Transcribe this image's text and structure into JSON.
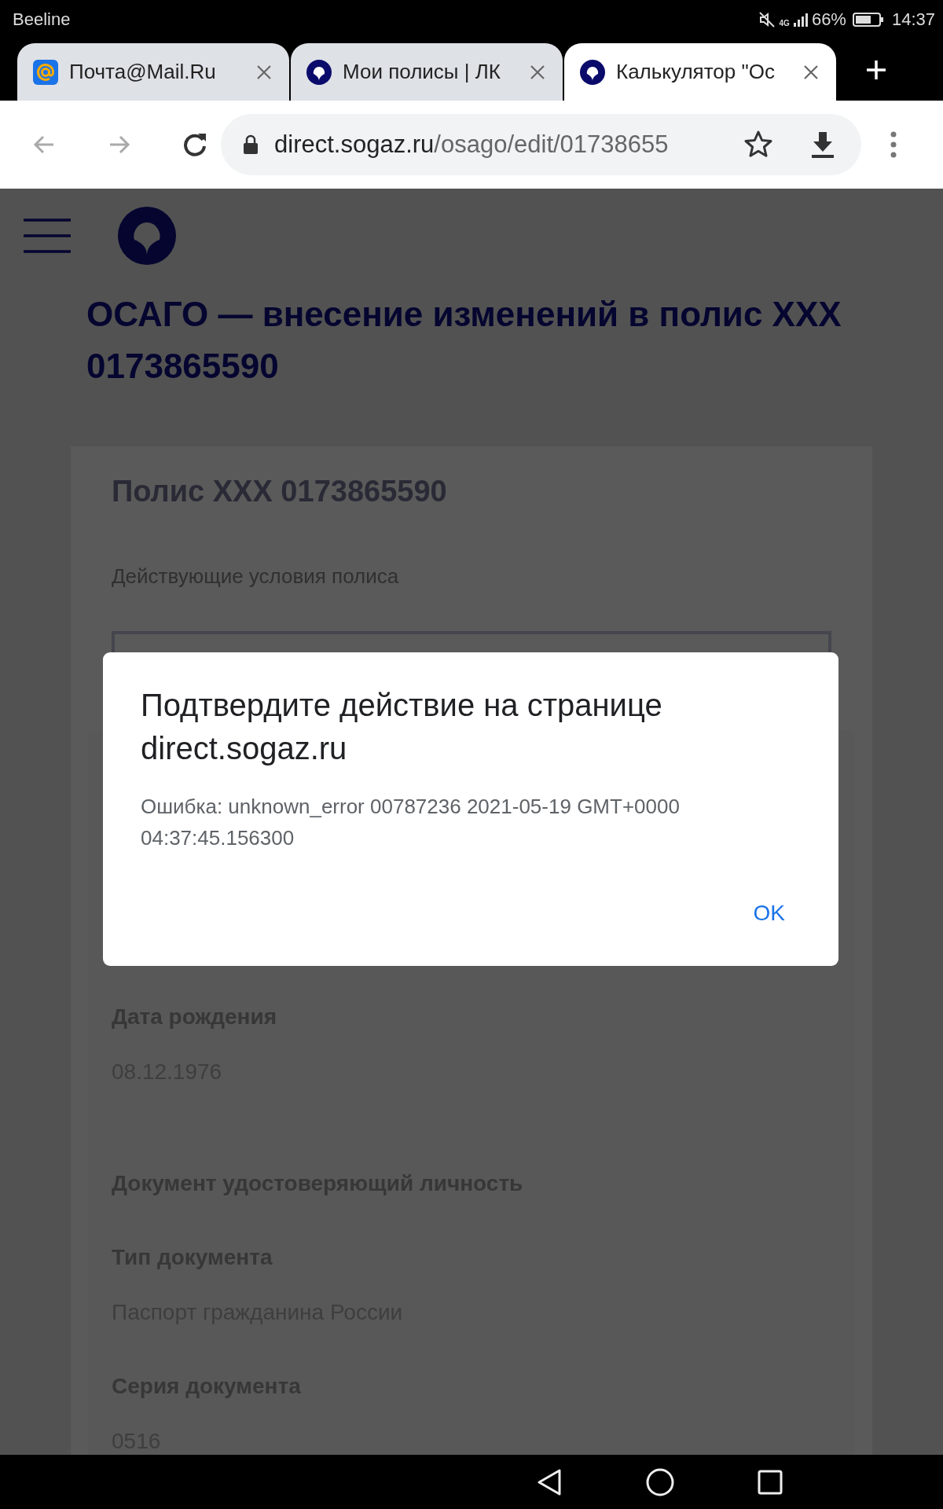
{
  "status_bar": {
    "carrier": "Beeline",
    "network": "4G",
    "battery": "66%",
    "time": "14:37",
    "muted": true
  },
  "tabs": [
    {
      "title": "Почта@Mail.Ru",
      "selected": false
    },
    {
      "title": "Мои полисы | ЛК",
      "selected": false
    },
    {
      "title": "Калькулятор \"Ос",
      "selected": true
    }
  ],
  "toolbar": {
    "back_disabled": true,
    "forward_disabled": true,
    "url_host": "direct.sogaz.ru",
    "url_path": "/osago/edit/01738655"
  },
  "page": {
    "title": "ОСАГО — внесение изменений в полис ХХХ 0173865590",
    "card": {
      "heading": "Полис ХХХ 0173865590",
      "subtitle": "Действующие условия полиса",
      "fields": [
        {
          "kind": "label",
          "text": "Дата рождения"
        },
        {
          "kind": "value",
          "text": "08.12.1976"
        },
        {
          "kind": "section",
          "text": "Документ удостоверяющий личность"
        },
        {
          "kind": "label",
          "text": "Тип документа"
        },
        {
          "kind": "value",
          "text": "Паспорт гражданина России"
        },
        {
          "kind": "label",
          "text": "Серия документа"
        },
        {
          "kind": "value",
          "text": "0516"
        }
      ]
    }
  },
  "dialog": {
    "title": "Подтвердите действие на странице direct.sogaz.ru",
    "message": "Ошибка: unknown_error 00787236 2021-05-19 GMT+0000 04:37:45.156300",
    "button": "OK"
  }
}
